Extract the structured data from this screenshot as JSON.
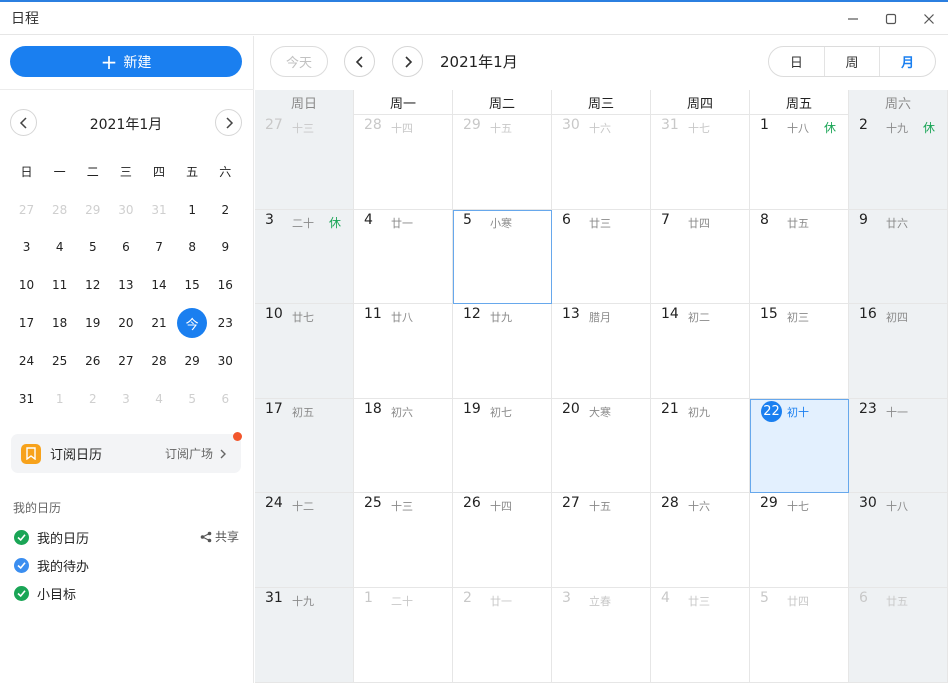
{
  "window": {
    "title": "日程"
  },
  "sidebar": {
    "new_button": "新建",
    "mini_calendar": {
      "title": "2021年1月",
      "weekdays": [
        "日",
        "一",
        "二",
        "三",
        "四",
        "五",
        "六"
      ],
      "weeks": [
        [
          {
            "d": "27",
            "dim": true
          },
          {
            "d": "28",
            "dim": true
          },
          {
            "d": "29",
            "dim": true
          },
          {
            "d": "30",
            "dim": true
          },
          {
            "d": "31",
            "dim": true
          },
          {
            "d": "1"
          },
          {
            "d": "2"
          }
        ],
        [
          {
            "d": "3"
          },
          {
            "d": "4"
          },
          {
            "d": "5"
          },
          {
            "d": "6"
          },
          {
            "d": "7"
          },
          {
            "d": "8"
          },
          {
            "d": "9"
          }
        ],
        [
          {
            "d": "10"
          },
          {
            "d": "11"
          },
          {
            "d": "12"
          },
          {
            "d": "13"
          },
          {
            "d": "14"
          },
          {
            "d": "15"
          },
          {
            "d": "16"
          }
        ],
        [
          {
            "d": "17"
          },
          {
            "d": "18"
          },
          {
            "d": "19"
          },
          {
            "d": "20"
          },
          {
            "d": "21"
          },
          {
            "d": "今",
            "today": true
          },
          {
            "d": "23"
          }
        ],
        [
          {
            "d": "24"
          },
          {
            "d": "25"
          },
          {
            "d": "26"
          },
          {
            "d": "27"
          },
          {
            "d": "28"
          },
          {
            "d": "29"
          },
          {
            "d": "30"
          }
        ],
        [
          {
            "d": "31"
          },
          {
            "d": "1",
            "dim": true
          },
          {
            "d": "2",
            "dim": true
          },
          {
            "d": "3",
            "dim": true
          },
          {
            "d": "4",
            "dim": true
          },
          {
            "d": "5",
            "dim": true
          },
          {
            "d": "6",
            "dim": true
          }
        ]
      ]
    },
    "subscribe": {
      "label": "订阅日历",
      "link": "订阅广场"
    },
    "section_title": "我的日历",
    "calendars": [
      {
        "label": "我的日历",
        "color": "#1aa556"
      },
      {
        "label": "我的待办",
        "color": "#3b8ef0"
      },
      {
        "label": "小目标",
        "color": "#1aa556"
      }
    ],
    "share_label": "共享"
  },
  "toolbar": {
    "today_label": "今天",
    "title": "2021年1月",
    "views": [
      "日",
      "周",
      "月"
    ],
    "active_view": "月"
  },
  "month_view": {
    "weekdays": [
      "周日",
      "周一",
      "周二",
      "周三",
      "周四",
      "周五",
      "周六"
    ],
    "weeks": [
      [
        {
          "n": "27",
          "l": "十三",
          "other": true
        },
        {
          "n": "28",
          "l": "十四",
          "other": true
        },
        {
          "n": "29",
          "l": "十五",
          "other": true
        },
        {
          "n": "30",
          "l": "十六",
          "other": true
        },
        {
          "n": "31",
          "l": "十七",
          "other": true
        },
        {
          "n": "1",
          "l": "十八",
          "h": "休"
        },
        {
          "n": "2",
          "l": "十九",
          "h": "休"
        }
      ],
      [
        {
          "n": "3",
          "l": "二十",
          "h": "休"
        },
        {
          "n": "4",
          "l": "廿一"
        },
        {
          "n": "5",
          "l": "小寒",
          "sel": true
        },
        {
          "n": "6",
          "l": "廿三"
        },
        {
          "n": "7",
          "l": "廿四"
        },
        {
          "n": "8",
          "l": "廿五"
        },
        {
          "n": "9",
          "l": "廿六"
        }
      ],
      [
        {
          "n": "10",
          "l": "廿七"
        },
        {
          "n": "11",
          "l": "廿八"
        },
        {
          "n": "12",
          "l": "廿九"
        },
        {
          "n": "13",
          "l": "腊月"
        },
        {
          "n": "14",
          "l": "初二"
        },
        {
          "n": "15",
          "l": "初三"
        },
        {
          "n": "16",
          "l": "初四"
        }
      ],
      [
        {
          "n": "17",
          "l": "初五"
        },
        {
          "n": "18",
          "l": "初六"
        },
        {
          "n": "19",
          "l": "初七"
        },
        {
          "n": "20",
          "l": "大寒"
        },
        {
          "n": "21",
          "l": "初九"
        },
        {
          "n": "22",
          "l": "初十",
          "today": true
        },
        {
          "n": "23",
          "l": "十一"
        }
      ],
      [
        {
          "n": "24",
          "l": "十二"
        },
        {
          "n": "25",
          "l": "十三"
        },
        {
          "n": "26",
          "l": "十四"
        },
        {
          "n": "27",
          "l": "十五"
        },
        {
          "n": "28",
          "l": "十六"
        },
        {
          "n": "29",
          "l": "十七"
        },
        {
          "n": "30",
          "l": "十八"
        }
      ],
      [
        {
          "n": "31",
          "l": "十九"
        },
        {
          "n": "1",
          "l": "二十",
          "other": true
        },
        {
          "n": "2",
          "l": "廿一",
          "other": true
        },
        {
          "n": "3",
          "l": "立春",
          "other": true
        },
        {
          "n": "4",
          "l": "廿三",
          "other": true
        },
        {
          "n": "5",
          "l": "廿四",
          "other": true
        },
        {
          "n": "6",
          "l": "廿五",
          "other": true
        }
      ]
    ]
  },
  "colors": {
    "accent": "#1a7ff0",
    "holiday": "#1aa556",
    "weekend_bg": "#eef1f3",
    "today_bg": "#e3f0fe"
  }
}
